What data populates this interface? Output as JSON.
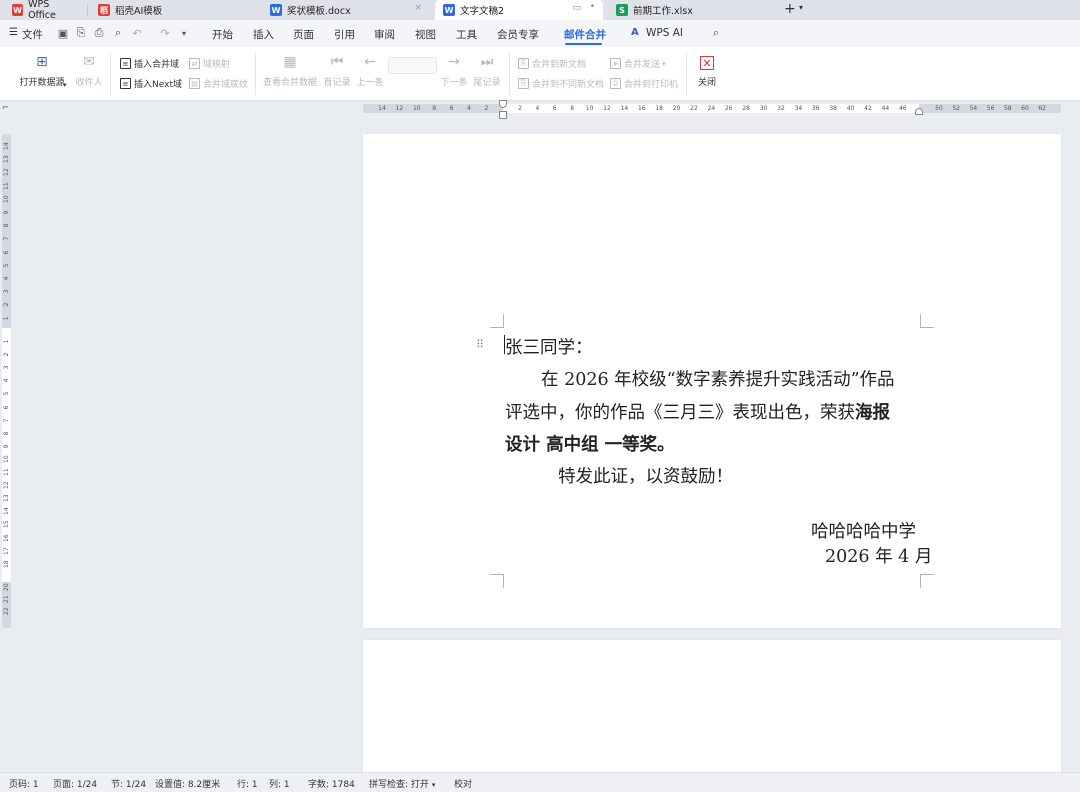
{
  "tabs": [
    {
      "label": "WPS Office",
      "icon": "wps-logo-icon",
      "color": "#e43d30"
    },
    {
      "label": "稻壳AI模板",
      "icon": "docer-icon",
      "color": "#e43d30"
    },
    {
      "label": "奖状模板.docx",
      "icon": "word-doc-icon",
      "color": "#2d6be4"
    },
    {
      "label": "文字文稿2",
      "icon": "word-doc-icon",
      "color": "#2d6be4",
      "active": true
    },
    {
      "label": "前期工作.xlsx",
      "icon": "sheet-icon",
      "color": "#1a9e5c"
    }
  ],
  "new_tab_label": "+",
  "menu": {
    "file_label": "文件",
    "items": [
      "开始",
      "插入",
      "页面",
      "引用",
      "审阅",
      "视图",
      "工具",
      "会员专享",
      "邮件合并",
      "WPS AI"
    ],
    "active_item": "邮件合并"
  },
  "ribbon": {
    "open_datasource": "打开数据源",
    "recipients": "收件人",
    "insert_merge_field": "插入合并域",
    "insert_next_field": "插入Next域",
    "field_mapping": "域映射",
    "merge_field_shading": "合并域底纹",
    "view_merged_data": "查看合并数据",
    "first_record": "首记录",
    "prev_record": "上一条",
    "next_record": "下一条",
    "last_record": "尾记录",
    "merge_to_new_doc": "合并到新文档",
    "merge_to_separate_docs": "合并到不同新文档",
    "merge_send": "合并发送",
    "merge_to_printer": "合并到打印机",
    "close": "关闭"
  },
  "document": {
    "greeting": "张三同学：",
    "body_line1": "在 2026 年校级“数字素养提升实践活动”作品",
    "body_line2_pre": "评选中，你的作品《三月三》表现出色，荣获",
    "body_line2_bold": "海报",
    "body_line3": "设计  高中组  一等奖。",
    "body_line4": "特发此证，以资鼓励！",
    "school": "哈哈哈哈中学",
    "date": "2026 年 4 月"
  },
  "ruler": {
    "h_left": [
      "14",
      "12",
      "10",
      "8",
      "6",
      "4",
      "2"
    ],
    "h_main": [
      "2",
      "4",
      "6",
      "8",
      "10",
      "12",
      "14",
      "16",
      "18",
      "20",
      "22",
      "24",
      "26",
      "28",
      "30",
      "32",
      "34",
      "36",
      "38",
      "40",
      "42",
      "44",
      "46"
    ],
    "h_right": [
      "50",
      "52",
      "54",
      "56",
      "58",
      "60",
      "62"
    ],
    "v_top": [
      "14",
      "13",
      "12",
      "11",
      "10",
      "9",
      "8",
      "7",
      "6",
      "5",
      "4",
      "3",
      "2",
      "1"
    ],
    "v_main": [
      "1",
      "2",
      "3",
      "4",
      "5",
      "6",
      "7",
      "8",
      "9",
      "10",
      "11",
      "12",
      "13",
      "14",
      "15",
      "16",
      "17",
      "18"
    ],
    "v_bottom": [
      "20",
      "21",
      "22"
    ]
  },
  "status": {
    "page_no": "页码: 1",
    "pages": "页面: 1/24",
    "section": "节: 1/24",
    "setting": "设置值: 8.2厘米",
    "row": "行: 1",
    "col": "列: 1",
    "word_count": "字数: 1784",
    "spell_check": "拼写检查: 打开",
    "proof": "校对"
  }
}
